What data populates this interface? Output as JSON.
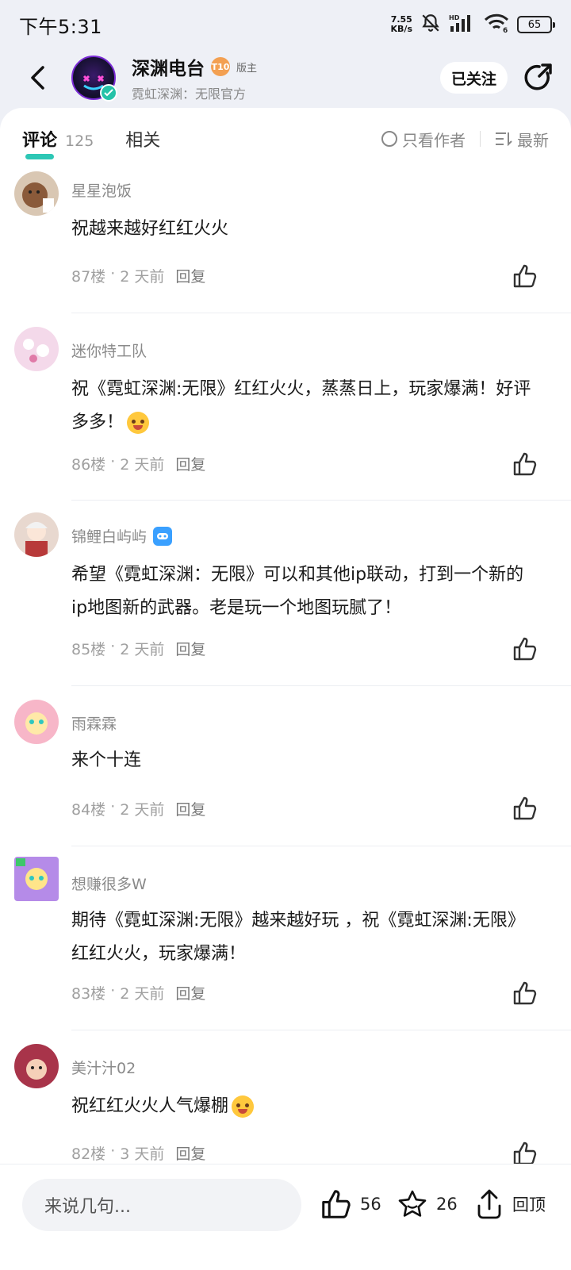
{
  "status_bar": {
    "time": "下午5:31",
    "net_speed_top": "7.55",
    "net_speed_unit": "KB/s",
    "hd_label": "HD",
    "wifi_label": "6",
    "battery": "65"
  },
  "header": {
    "title": "深渊电台",
    "level_badge": "T10",
    "role": "版主",
    "subtitle": "霓虹深渊：无限官方",
    "follow_label": "已关注"
  },
  "tabs": {
    "comments_label": "评论",
    "comments_count": "125",
    "related_label": "相关",
    "author_only_label": "只看作者",
    "sort_label": "最新"
  },
  "comments": [
    {
      "name": "星星泡饭",
      "text": "祝越来越好红红火火",
      "floor": "87楼",
      "time": "2 天前",
      "reply": "回复",
      "avatar_color": "#d9c7b3"
    },
    {
      "name": "迷你特工队",
      "text": "祝《霓虹深渊:无限》红红火火，蒸蒸日上，玩家爆满！好评多多！",
      "floor": "86楼",
      "time": "2 天前",
      "reply": "回复",
      "avatar_color": "#f4d9ea"
    },
    {
      "name": "锦鲤白屿屿",
      "text": "希望《霓虹深渊：无限》可以和其他ip联动，打到一个新的ip地图新的武器。老是玩一个地图玩腻了！",
      "floor": "85楼",
      "time": "2 天前",
      "reply": "回复",
      "avatar_color": "#e8d8cf"
    },
    {
      "name": "雨霖霖",
      "text": "来个十连",
      "floor": "84楼",
      "time": "2 天前",
      "reply": "回复",
      "avatar_color": "#f7b6c8"
    },
    {
      "name": "想赚很多W",
      "text": "期待《霓虹深渊:无限》越来越好玩 ，祝《霓虹深渊:无限》红红火火，玩家爆满！",
      "floor": "83楼",
      "time": "2 天前",
      "reply": "回复",
      "avatar_color": "#b58be8"
    },
    {
      "name": "美汁汁02",
      "text": "祝红红火火人气爆棚",
      "floor": "82楼",
      "time": "3 天前",
      "reply": "回复",
      "avatar_color": "#a8344a"
    }
  ],
  "bottom_bar": {
    "input_placeholder": "来说几句...",
    "like_count": "56",
    "fav_count": "26",
    "top_label": "回顶"
  },
  "colors": {
    "accent": "#2dc7b5",
    "background": "#eef0f6"
  }
}
